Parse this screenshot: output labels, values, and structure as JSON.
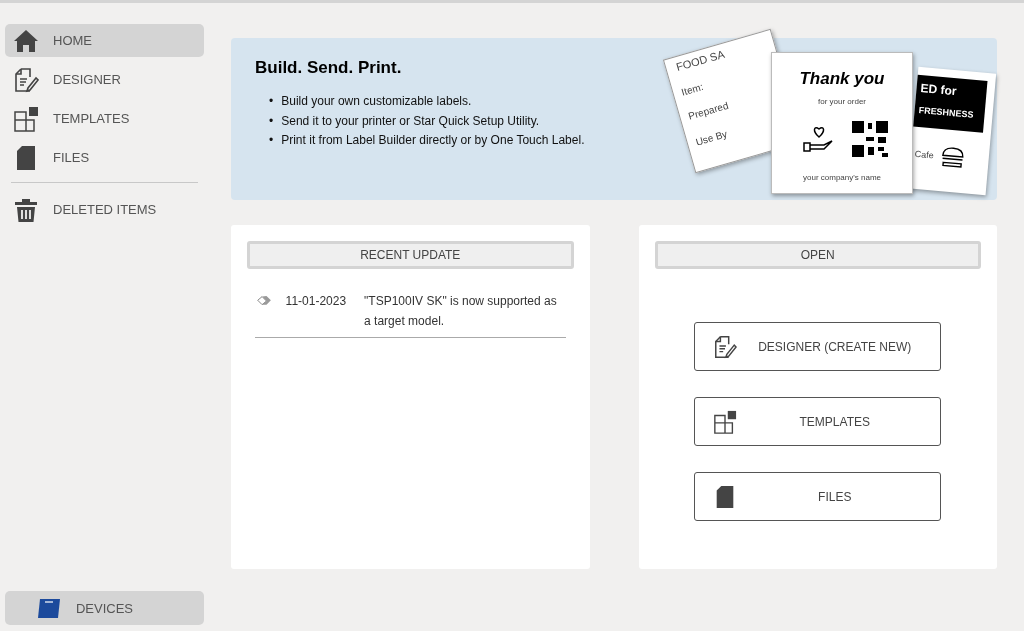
{
  "sidebar": {
    "sections": [
      [
        {
          "label": "HOME",
          "kind": "home",
          "selected": true
        },
        {
          "label": "DESIGNER",
          "kind": "designer",
          "selected": false
        },
        {
          "label": "TEMPLATES",
          "kind": "templates",
          "selected": false
        },
        {
          "label": "FILES",
          "kind": "files",
          "selected": false
        }
      ],
      [
        {
          "label": "DELETED ITEMS",
          "kind": "trash",
          "selected": false
        }
      ]
    ],
    "devices_button": "DEVICES"
  },
  "banner": {
    "title": "Build. Send. Print.",
    "marker": "•",
    "bullets": [
      "Build your own customizable labels.",
      "Send it to your printer or Star Quick Setup Utility.",
      "Print it from Label Builder directly or by One Touch Label."
    ],
    "labels": {
      "left": [
        "FOOD SA",
        "Item:",
        "Prepared",
        "Use By"
      ],
      "center": {
        "title": "Thank you",
        "subtitle": "for your order",
        "footer": "your company's name"
      },
      "right": {
        "banner": [
          "ED for",
          "FRESHNESS"
        ],
        "caption": "Cafe"
      }
    }
  },
  "recent_update": {
    "heading": "RECENT UPDATE",
    "entries": [
      {
        "date": "11-01-2023",
        "text": "\"TSP100IV SK\" is now supported as a target model."
      }
    ]
  },
  "open": {
    "heading": "OPEN",
    "buttons": [
      {
        "label": "DESIGNER (CREATE NEW)",
        "kind": "designer"
      },
      {
        "label": "TEMPLATES",
        "kind": "templates"
      },
      {
        "label": "FILES",
        "kind": "files"
      }
    ]
  }
}
